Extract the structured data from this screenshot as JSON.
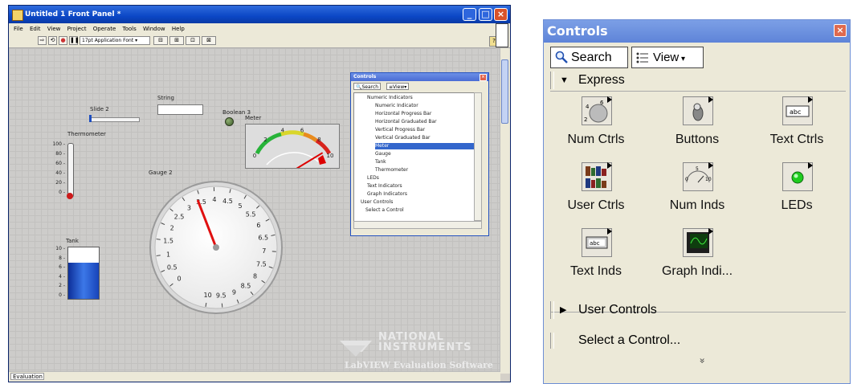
{
  "front_panel": {
    "title": "Untitled 1 Front Panel *",
    "menu": [
      "File",
      "Edit",
      "View",
      "Project",
      "Operate",
      "Tools",
      "Window",
      "Help"
    ],
    "font_select": "17pt Application Font",
    "eval_tab": "Evaluation",
    "controls": {
      "slide_label": "Slide 2",
      "string_label": "String",
      "boolean_label": "Boolean 3",
      "thermometer_label": "Thermometer",
      "thermometer_ticks": [
        "100",
        "80",
        "60",
        "40",
        "20",
        "0"
      ],
      "tank_label": "Tank",
      "tank_ticks": [
        "10",
        "8",
        "6",
        "4",
        "2",
        "0"
      ],
      "tank_level": 0.7,
      "gauge_label": "Gauge 2",
      "gauge_ticks": [
        "0",
        "0.5",
        "1",
        "1.5",
        "2",
        "2.5",
        "3",
        "3.5",
        "4",
        "4.5",
        "5",
        "5.5",
        "6",
        "6.5",
        "7",
        "7.5",
        "8",
        "8.5",
        "9",
        "9.5",
        "10"
      ],
      "gauge_value": 3.4,
      "meter_label": "Meter",
      "meter_ticks": [
        "0",
        "2",
        "4",
        "6",
        "8",
        "10"
      ],
      "meter_value": 9.2
    },
    "watermark": {
      "name_line1": "NATIONAL",
      "name_line2": "INSTRUMENTS",
      "tagline": "LabVIEW Evaluation Software"
    },
    "mini_palette": {
      "title": "Controls",
      "search": "Search",
      "view": "View",
      "tree": [
        "Numeric Indicators",
        "Numeric Indicator",
        "Horizontal Progress Bar",
        "Horizontal Graduated Bar",
        "Vertical Progress Bar",
        "Vertical Graduated Bar",
        "Meter",
        "Gauge",
        "Tank",
        "Thermometer",
        "LEDs",
        "Text Indicators",
        "Graph Indicators",
        "User Controls",
        "Select a Control"
      ],
      "selected_index": 6
    }
  },
  "controls_palette": {
    "title": "Controls",
    "close": "×",
    "search_label": "Search",
    "view_label": "View",
    "express_label": "Express",
    "items": [
      {
        "label": "Num Ctrls",
        "icon": "numeric-knob-icon"
      },
      {
        "label": "Buttons",
        "icon": "toggle-switch-icon"
      },
      {
        "label": "Text Ctrls",
        "icon": "text-box-icon"
      },
      {
        "label": "User Ctrls",
        "icon": "user-controls-icon"
      },
      {
        "label": "Num Inds",
        "icon": "meter-icon"
      },
      {
        "label": "LEDs",
        "icon": "green-led-icon"
      },
      {
        "label": "Text Inds",
        "icon": "text-indicator-icon"
      },
      {
        "label": "Graph Indi...",
        "icon": "graph-icon"
      }
    ],
    "user_controls_label": "User Controls",
    "select_control_label": "Select a Control...",
    "more_glyph": "»"
  }
}
